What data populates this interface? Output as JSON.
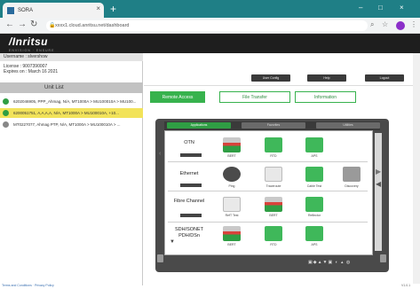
{
  "browser": {
    "tab_title": "SORA",
    "tab_close": "×",
    "new_tab": "+",
    "url": "xxxx1.cloud.anritsu.net/dashboard",
    "win_min": "–",
    "win_max": "□",
    "win_close": "×"
  },
  "app": {
    "logo": "/Inritsu",
    "tagline": "ENVISION · ENSURE"
  },
  "left": {
    "username": "Username : slvershow",
    "license_line1": "License : 9007390007",
    "license_line2": "Expires on : March 16 2021",
    "unit_list_header": "Unit List",
    "units": [
      {
        "label": "6202046905, PPP_Ahmag, N/A, MT1000A > MU100010A > MU100...",
        "color": "#2f9e44",
        "highlight": false
      },
      {
        "label": "6200051751, A,A,A,A, N/A, MT1000A > MU100010A, +10...",
        "color": "#2f9e44",
        "highlight": true
      },
      {
        "label": "MT0227077, Ahmag PTP, N/A, MT1000A > MU100010A > ...",
        "color": "#777777",
        "highlight": false
      }
    ],
    "footer_link": "Terms and Conditions · Privacy Policy"
  },
  "right": {
    "top_buttons": [
      "User Config",
      "Help",
      "Logout"
    ],
    "actions": [
      "Remote Access",
      "File Transfer",
      "Information"
    ],
    "device_tabs": [
      "Applications",
      "Favorites",
      "Utilities"
    ],
    "categories": [
      {
        "name": "OTN",
        "apps": [
          "BERT",
          "RTD",
          "APS"
        ]
      },
      {
        "name": "Ethernet",
        "apps": [
          "Ping",
          "Traceroute",
          "Cable Test",
          "Discovery"
        ]
      },
      {
        "name": "Fibre Channel",
        "apps": [
          "RefT Test",
          "BERT",
          "Reflector"
        ]
      },
      {
        "name": "SDH/SONET PDH/DSn",
        "apps": [
          "BERT",
          "RTD",
          "APS"
        ]
      }
    ],
    "footer_right": "V1.0.1"
  },
  "colors": {
    "accent_green": "#37b24d",
    "chrome_teal": "#1f7f86",
    "header_dark": "#1e1e1e"
  }
}
